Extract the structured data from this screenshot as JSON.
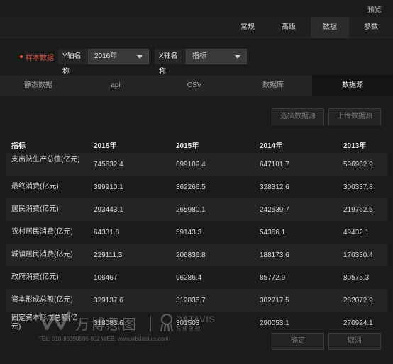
{
  "topbar": {
    "preview_label": "预览"
  },
  "config_tabs": [
    "常规",
    "高级",
    "数据",
    "参数"
  ],
  "axis": {
    "sample_label": "样本数据",
    "y_label": "Y轴名称",
    "y_value": "2016年",
    "x_label": "X轴名称",
    "x_value": "指标"
  },
  "source_tabs": [
    "静态数据",
    "api",
    "CSV",
    "数据库",
    "数据源"
  ],
  "source_buttons": {
    "select": "选择数据源",
    "upload": "上传数据源"
  },
  "table": {
    "headers": [
      "指标",
      "2016年",
      "2015年",
      "2014年",
      "2013年"
    ],
    "rows": [
      [
        "支出法生产总值(亿元)",
        "745632.4",
        "699109.4",
        "647181.7",
        "596962.9"
      ],
      [
        "最终消费(亿元)",
        "399910.1",
        "362266.5",
        "328312.6",
        "300337.8"
      ],
      [
        "居民消费(亿元)",
        "293443.1",
        "265980.1",
        "242539.7",
        "219762.5"
      ],
      [
        "农村居民消费(亿元)",
        "64331.8",
        "59143.3",
        "54366.1",
        "49432.1"
      ],
      [
        "城镇居民消费(亿元)",
        "229111.3",
        "206836.8",
        "188173.6",
        "170330.4"
      ],
      [
        "政府消费(亿元)",
        "106467",
        "96286.4",
        "85772.9",
        "80575.3"
      ],
      [
        "资本形成总额(亿元)",
        "329137.6",
        "312835.7",
        "302717.5",
        "282072.9"
      ],
      [
        "固定资本形成总额(亿元)",
        "318083.6",
        "301503",
        "290053.1",
        "270924.1"
      ]
    ]
  },
  "watermark": {
    "brand_cn": "万博思图",
    "brand_en": "DATAVIS",
    "brand_en_sub": "万博思图",
    "contact": "TEL: 010-86390986-802   WEB: www.wbdatavis.com"
  },
  "footer": {
    "confirm": "确定",
    "cancel": "取消"
  }
}
